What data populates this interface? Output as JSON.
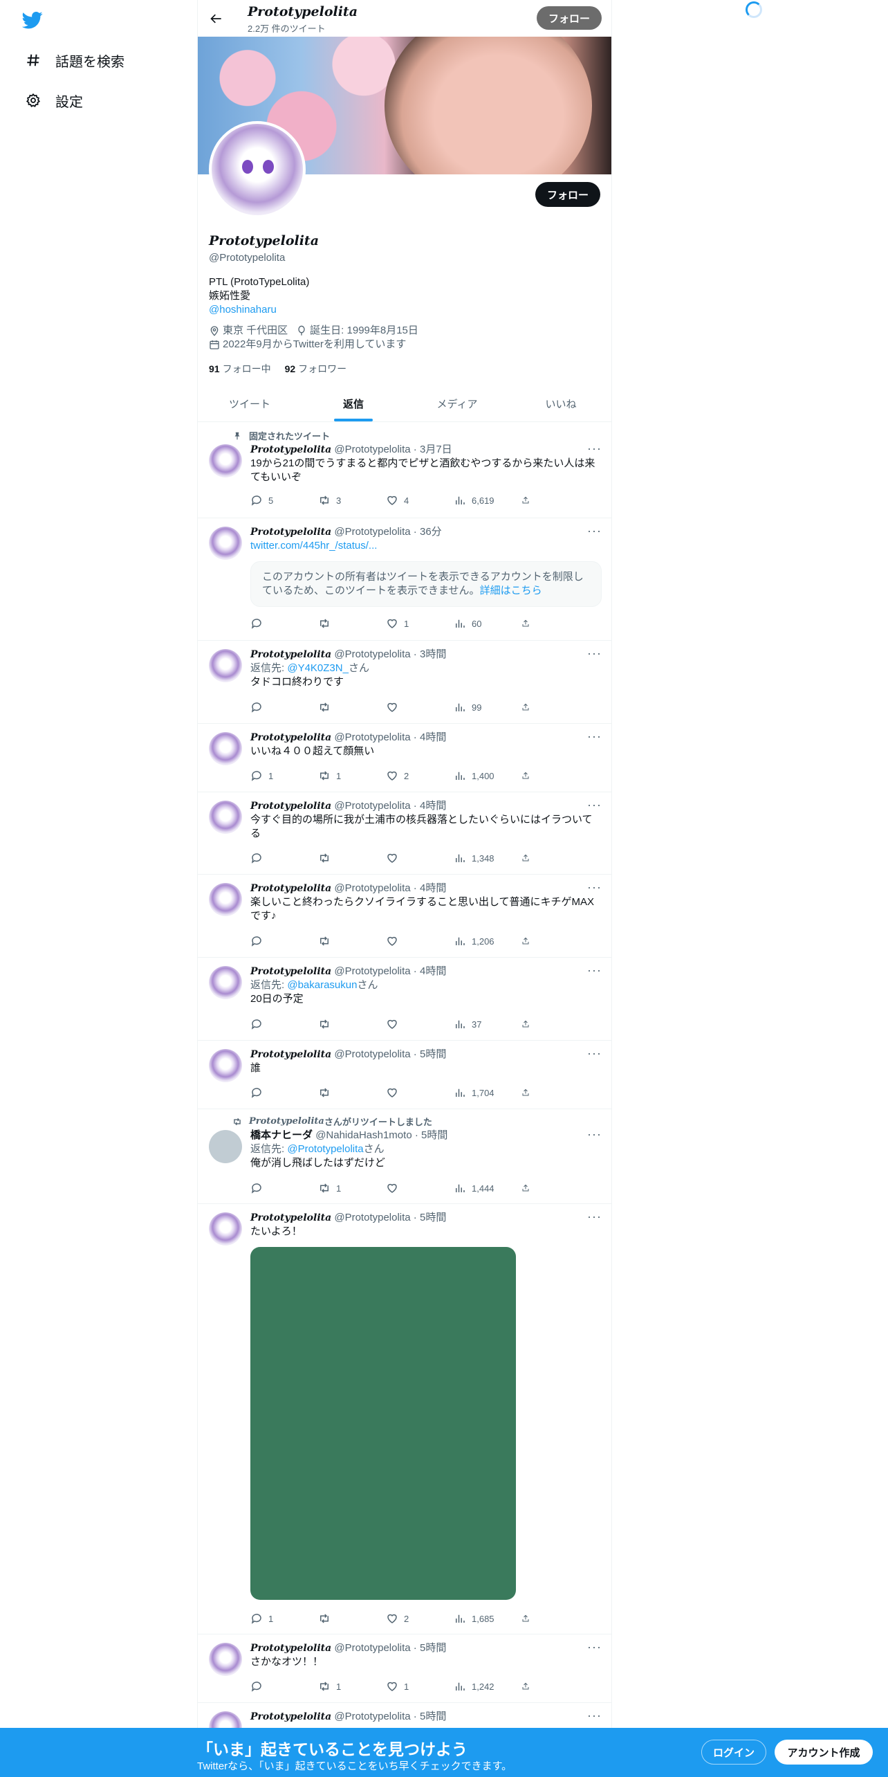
{
  "nav": {
    "explore_label": "話題を検索",
    "settings_label": "設定"
  },
  "header": {
    "name": "Prototypelolita",
    "tweet_count": "2.2万 件のツイート",
    "follow_label": "フォロー"
  },
  "profile": {
    "follow_label": "フォロー",
    "name": "Prototypelolita",
    "handle": "@Prototypelolita",
    "bio_line1": "PTL (ProtoTypeLolita)",
    "bio_line2": "嫉妬性愛",
    "bio_link": "@hoshinaharu",
    "location": "東京 千代田区",
    "birthday": "誕生日: 1999年8月15日",
    "joined": "2022年9月からTwitterを利用しています",
    "following_count": "91",
    "following_label": "フォロー中",
    "followers_count": "92",
    "followers_label": "フォロワー"
  },
  "tabs": [
    "ツイート",
    "返信",
    "メディア",
    "いいね"
  ],
  "pinned_label": "固定されたツイート",
  "tweets": [
    {
      "name": "Prototypelolita",
      "handle": "@Prototypelolita",
      "time": "3月7日",
      "text": "19から21の間でうすまると都内でピザと酒飲むやつするから来たい人は来てもいいぞ",
      "reply": "0",
      "reply_count": "5",
      "rt": "3",
      "like": "4",
      "views": "6,619"
    },
    {
      "name": "Prototypelolita",
      "handle": "@Prototypelolita",
      "time": "36分",
      "link": "twitter.com/445hr_/status/...",
      "notice": "このアカウントの所有者はツイートを表示できるアカウントを制限しているため、このツイートを表示できません。",
      "notice_link": "詳細はこちら",
      "reply_count": "",
      "rt": "",
      "like": "1",
      "views": "60"
    },
    {
      "name": "Prototypelolita",
      "handle": "@Prototypelolita",
      "time": "3時間",
      "reply_prefix": "返信先: ",
      "reply_to": "@Y4K0Z3N_",
      "reply_suffix": "さん",
      "text": "タドコロ終わりです",
      "reply_count": "",
      "rt": "",
      "like": "",
      "views": "99"
    },
    {
      "name": "Prototypelolita",
      "handle": "@Prototypelolita",
      "time": "4時間",
      "text": "いいね４００超えて顔無い",
      "reply_count": "1",
      "rt": "1",
      "like": "2",
      "views": "1,400"
    },
    {
      "name": "Prototypelolita",
      "handle": "@Prototypelolita",
      "time": "4時間",
      "text": "今すぐ目的の場所に我が土浦市の核兵器落としたいぐらいにはイラついてる",
      "reply_count": "",
      "rt": "",
      "like": "",
      "views": "1,348"
    },
    {
      "name": "Prototypelolita",
      "handle": "@Prototypelolita",
      "time": "4時間",
      "text": "楽しいこと終わったらクソイライラすること思い出して普通にキチゲMAXです♪",
      "reply_count": "",
      "rt": "",
      "like": "",
      "views": "1,206"
    },
    {
      "name": "Prototypelolita",
      "handle": "@Prototypelolita",
      "time": "4時間",
      "reply_prefix": "返信先: ",
      "reply_to": "@bakarasukun",
      "reply_suffix": "さん",
      "text": "20日の予定",
      "reply_count": "",
      "rt": "",
      "like": "",
      "views": "37"
    },
    {
      "name": "Prototypelolita",
      "handle": "@Prototypelolita",
      "time": "5時間",
      "text": "誰",
      "reply_count": "",
      "rt": "",
      "like": "",
      "views": "1,704"
    },
    {
      "retweeter": "Prototypelolita",
      "retweet_suffix": "さんがリツイートしました",
      "name": "橋本ナヒーダ",
      "handle": "@NahidaHash1moto",
      "time": "5時間",
      "reply_prefix": "返信先: ",
      "reply_to": "@Prototypelolita",
      "reply_suffix": "さん",
      "text": "俺が消し飛ばしたはずだけど",
      "reply_count": "",
      "rt": "1",
      "like": "",
      "views": "1,444"
    },
    {
      "name": "Prototypelolita",
      "handle": "@Prototypelolita",
      "time": "5時間",
      "text": "たいよろ！",
      "reply_count": "1",
      "rt": "",
      "like": "2",
      "views": "1,685"
    },
    {
      "name": "Prototypelolita",
      "handle": "@Prototypelolita",
      "time": "5時間",
      "text": "さかなオツ！！",
      "reply_count": "",
      "rt": "1",
      "like": "1",
      "views": "1,242"
    },
    {
      "name": "Prototypelolita",
      "handle": "@Prototypelolita",
      "time": "5時間"
    }
  ],
  "bottom": {
    "title": "「いま」起きていることを見つけよう",
    "subtitle": "Twitterなら、「いま」起きていることをいち早くチェックできます。",
    "login": "ログイン",
    "signup": "アカウント作成"
  },
  "colors": {
    "accent": "#1d9bf0",
    "media": "#3a7a5c"
  }
}
